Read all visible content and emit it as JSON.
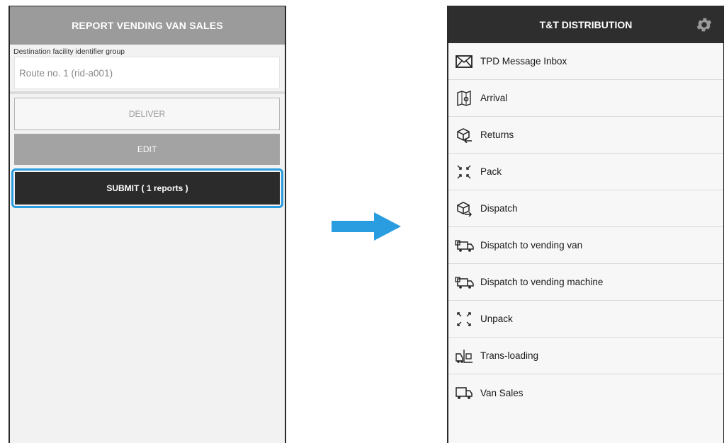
{
  "left_screen": {
    "title": "REPORT VENDING VAN SALES",
    "field_label": "Destination facility identifier group",
    "field_value": "Route no. 1 (rid-a001)",
    "deliver_label": "DELIVER",
    "edit_label": "EDIT",
    "submit_label": "SUBMIT ( 1 reports )"
  },
  "right_screen": {
    "title": "T&T DISTRIBUTION",
    "menu": [
      {
        "label": "TPD Message Inbox",
        "icon": "envelope-icon"
      },
      {
        "label": "Arrival",
        "icon": "map-pin-icon"
      },
      {
        "label": "Returns",
        "icon": "box-return-icon"
      },
      {
        "label": "Pack",
        "icon": "pack-arrows-icon"
      },
      {
        "label": "Dispatch",
        "icon": "box-dispatch-icon"
      },
      {
        "label": "Dispatch to vending van",
        "icon": "truck-box-icon"
      },
      {
        "label": "Dispatch to vending machine",
        "icon": "truck-box-icon"
      },
      {
        "label": "Unpack",
        "icon": "unpack-arrows-icon"
      },
      {
        "label": "Trans-loading",
        "icon": "forklift-icon"
      },
      {
        "label": "Van Sales",
        "icon": "van-icon"
      }
    ]
  },
  "colors": {
    "accent_arrow": "#2a9ce0",
    "header_dark": "#2e2e2e",
    "header_gray": "#9b9b9b",
    "submit_ring": "#2a9ce0"
  }
}
